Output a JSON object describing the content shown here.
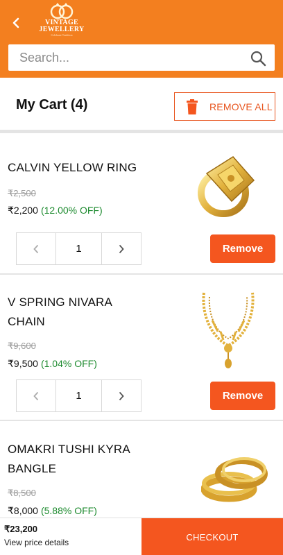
{
  "header": {
    "logo_line1": "VINTAGE",
    "logo_line2": "JEWELLERY",
    "logo_tagline": "Celebrate Tradition",
    "back_icon": "chevron-left-icon",
    "brand_color": "#f37f1f"
  },
  "search": {
    "placeholder": "Search...",
    "icon": "search-icon"
  },
  "cart": {
    "title": "My Cart (4)",
    "remove_all_label": "REMOVE ALL",
    "remove_all_icon": "trash-icon",
    "accent_color": "#f4561f"
  },
  "items": [
    {
      "name": "CALVIN YELLOW RING",
      "mrp": "₹2,500",
      "price": "₹2,200",
      "discount": "(12.00% OFF)",
      "quantity": "1",
      "remove_label": "Remove",
      "image": "gold-ring-image"
    },
    {
      "name": "V SPRING NIVARA CHAIN",
      "mrp": "₹9,600",
      "price": "₹9,500",
      "discount": "(1.04% OFF)",
      "quantity": "1",
      "remove_label": "Remove",
      "image": "gold-necklace-image"
    },
    {
      "name": "OMAKRI TUSHI KYRA BANGLE",
      "mrp": "₹8,500",
      "price": "₹8,000",
      "discount": "(5.88% OFF)",
      "image": "gold-bangles-image"
    }
  ],
  "footer": {
    "total": "₹23,200",
    "view_details": "View price details",
    "checkout_label": "CHECKOUT"
  }
}
